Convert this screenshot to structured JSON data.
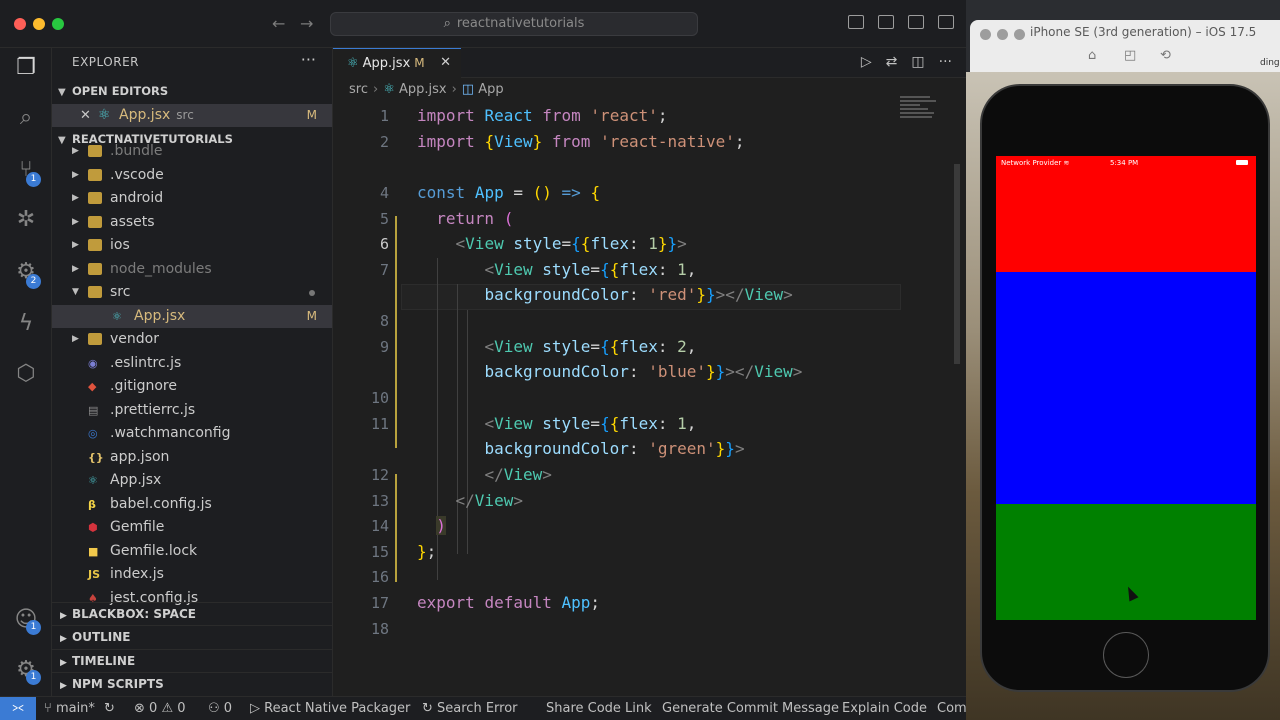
{
  "vscode": {
    "search_placeholder": "reactnativetutorials"
  },
  "activity_badges": {
    "source_control": "1",
    "extensions": "2",
    "accounts": "1",
    "settings": "1"
  },
  "explorer": {
    "title": "EXPLORER",
    "open_editors_label": "OPEN EDITORS",
    "open_editor": {
      "name": "App.jsx",
      "folder": "src",
      "status": "M"
    },
    "project_label": "REACTNATIVETUTORIALS",
    "tree": [
      {
        "name": ".bundle",
        "type": "folder",
        "dim": true,
        "indent": 1
      },
      {
        "name": ".vscode",
        "type": "folder",
        "indent": 1
      },
      {
        "name": "android",
        "type": "folder",
        "indent": 1
      },
      {
        "name": "assets",
        "type": "folder",
        "indent": 1
      },
      {
        "name": "ios",
        "type": "folder",
        "indent": 1
      },
      {
        "name": "node_modules",
        "type": "folder",
        "dim": true,
        "indent": 1
      },
      {
        "name": "src",
        "type": "folder",
        "open": true,
        "indent": 1,
        "dot": true
      },
      {
        "name": "App.jsx",
        "type": "react",
        "indent": 2,
        "status": "M",
        "selected": true
      },
      {
        "name": "vendor",
        "type": "folder",
        "indent": 1
      },
      {
        "name": ".eslintrc.js",
        "type": "eslint",
        "indent": 1
      },
      {
        "name": ".gitignore",
        "type": "git",
        "indent": 1
      },
      {
        "name": ".prettierrc.js",
        "type": "prettier",
        "indent": 1
      },
      {
        "name": ".watchmanconfig",
        "type": "watchman",
        "indent": 1
      },
      {
        "name": "app.json",
        "type": "json",
        "indent": 1
      },
      {
        "name": "App.jsx",
        "type": "react",
        "indent": 1
      },
      {
        "name": "babel.config.js",
        "type": "babel",
        "indent": 1
      },
      {
        "name": "Gemfile",
        "type": "ruby",
        "indent": 1
      },
      {
        "name": "Gemfile.lock",
        "type": "lock",
        "indent": 1
      },
      {
        "name": "index.js",
        "type": "js",
        "indent": 1
      },
      {
        "name": "jest.config.js",
        "type": "jest",
        "indent": 1
      }
    ],
    "bottom_sections": [
      "BLACKBOX: SPACE",
      "OUTLINE",
      "TIMELINE",
      "NPM SCRIPTS"
    ]
  },
  "editor": {
    "tab": {
      "name": "App.jsx",
      "status": "M"
    },
    "breadcrumb": [
      "src",
      "App.jsx",
      "App"
    ],
    "current_line": "6"
  },
  "statusbar": {
    "branch": "main*",
    "errors": "0",
    "warnings": "0",
    "ports": "0",
    "items": [
      "React Native Packager",
      "Search Error",
      "Share Code Link",
      "Generate Commit Message",
      "Explain Code",
      "Com"
    ]
  },
  "simulator": {
    "title": "iPhone SE (3rd generation) – iOS 17.5",
    "provider": "Network Provider",
    "clock": "5:34 PM",
    "side_text": "ding",
    "boxes": [
      {
        "color": "#ff0000",
        "flex": 1
      },
      {
        "color": "#0000ff",
        "flex": 2
      },
      {
        "color": "#008000",
        "flex": 1
      }
    ]
  }
}
